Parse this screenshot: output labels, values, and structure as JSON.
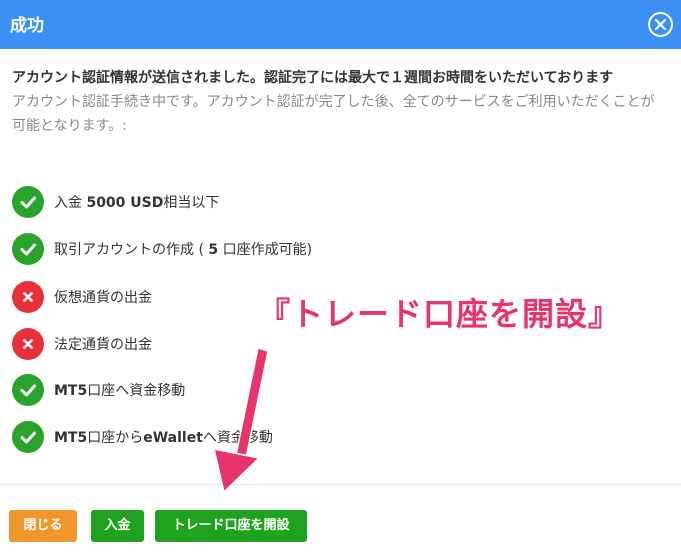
{
  "header": {
    "title": "成功",
    "close_icon": "close-circle-icon"
  },
  "message": {
    "bold": "アカウント認証情報が送信されました。認証完了には最大で１週間お時間をいただいております",
    "normal": "アカウント認証手続き中です。アカウント認証が完了した後、全てのサービスをご利用いただくことが可能となります。:"
  },
  "features": [
    {
      "text_pre": "入金 ",
      "text_bold": "5000 USD",
      "text_post": "相当以下",
      "status": "ok"
    },
    {
      "text_pre": "取引アカウントの作成 ( ",
      "text_bold": "5",
      "text_post": " 口座作成可能)",
      "status": "ok"
    },
    {
      "text_pre": "仮想通貨の出金",
      "text_bold": "",
      "text_post": "",
      "status": "no"
    },
    {
      "text_pre": "法定通貨の出金",
      "text_bold": "",
      "text_post": "",
      "status": "no"
    },
    {
      "text_pre": "",
      "text_bold": "MT5",
      "text_post": "口座へ資金移動",
      "status": "ok"
    },
    {
      "text_pre": "",
      "text_bold": "MT5",
      "text_post": "口座から",
      "text_bold2": "eWallet",
      "text_post2": "へ資金移動",
      "status": "ok"
    }
  ],
  "footer": {
    "close_label": "閉じる",
    "deposit_label": "入金",
    "open_account_label": "トレード口座を開設"
  },
  "annotation": {
    "text": "『トレード口座を開設』"
  },
  "colors": {
    "header_bg": "#3b8ff5",
    "ok": "#2aa32a",
    "no": "#e8303a",
    "close_btn": "#f0962a",
    "green_btn": "#1fa31f",
    "annotation": "#e8336b"
  }
}
